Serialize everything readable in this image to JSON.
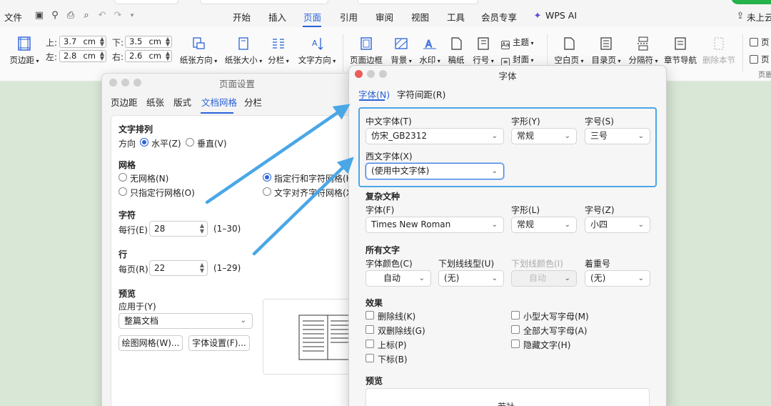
{
  "menu": {
    "file": "文件",
    "tabs": [
      "开始",
      "插入",
      "页面",
      "引用",
      "审阅",
      "视图",
      "工具",
      "会员专享",
      "WPS AI"
    ],
    "active_tab": "页面",
    "cloud": "未上云"
  },
  "ribbon": {
    "margins_btn": "页边距",
    "top_label": "上:",
    "top_value": "3.7",
    "top_unit": "cm",
    "bottom_label": "下:",
    "bottom_value": "3.5",
    "bottom_unit": "cm",
    "left_label": "左:",
    "left_value": "2.8",
    "left_unit": "cm",
    "right_label": "右:",
    "right_value": "2.6",
    "right_unit": "cm",
    "orientation": "纸张方向",
    "size": "纸张大小",
    "columns": "分栏",
    "text_direction": "文字方向",
    "page_border": "页面边框",
    "background": "背景",
    "watermark": "水印",
    "manuscript": "稿纸",
    "line_number": "行号",
    "theme": "主题",
    "cover": "封面",
    "blank_page": "空白页",
    "toc_page": "目录页",
    "separator": "分隔符",
    "section_nav": "章节导航",
    "delete_section": "删除本节",
    "partial_right_1": "页",
    "partial_right_2": "页",
    "partial_right_3": "页眉"
  },
  "page_setup": {
    "title": "页面设置",
    "partial_caption": "页面设置",
    "tabs": [
      "页边距",
      "纸张",
      "版式",
      "文档网格",
      "分栏"
    ],
    "active_tab": "文档网格",
    "text_layout_heading": "文字排列",
    "direction_label": "方向",
    "horizontal": "水平(Z)",
    "vertical": "垂直(V)",
    "grid_heading": "网格",
    "no_grid": "无网格(N)",
    "line_only": "只指定行网格(O)",
    "line_and_char": "指定行和字符网格(H)",
    "align_char": "文字对齐字符网格(X)",
    "chars_heading": "字符",
    "per_line_label": "每行(E)",
    "per_line_value": "28",
    "per_line_range": "(1–30)",
    "lines_heading": "行",
    "per_page_label": "每页(R)",
    "per_page_value": "22",
    "per_page_range": "(1–29)",
    "preview_heading": "预览",
    "apply_to_label": "应用于(Y)",
    "apply_to_value": "整篇文档",
    "draw_grid_btn": "绘图网格(W)...",
    "font_settings_btn": "字体设置(F)..."
  },
  "font_dialog": {
    "title": "字体",
    "tabs": [
      "字体(N)",
      "字符间距(R)"
    ],
    "active_tab": "字体(N)",
    "cn_font_label": "中文字体(T)",
    "cn_font_value": "仿宋_GB2312",
    "style_label": "字形(Y)",
    "style_value": "常规",
    "size_label": "字号(S)",
    "size_value": "三号",
    "west_font_label": "西文字体(X)",
    "west_font_value": "(使用中文字体)",
    "complex_heading": "复杂文种",
    "complex_font_label": "字体(F)",
    "complex_font_value": "Times New Roman",
    "complex_style_label": "字形(L)",
    "complex_style_value": "常规",
    "complex_size_label": "字号(Z)",
    "complex_size_value": "小四",
    "all_text_heading": "所有文字",
    "color_label": "字体颜色(C)",
    "color_value": "自动",
    "underline_label": "下划线线型(U)",
    "underline_value": "(无)",
    "underline_color_label": "下划线颜色(I)",
    "underline_color_value": "自动",
    "emphasis_label": "着重号",
    "emphasis_value": "(无)",
    "effects_heading": "效果",
    "strike": "删除线(K)",
    "double_strike": "双删除线(G)",
    "superscript": "上标(P)",
    "subscript": "下标(B)",
    "small_caps": "小型大写字母(M)",
    "all_caps": "全部大写字母(A)",
    "hidden": "隐藏文字(H)",
    "preview_heading": "预览",
    "preview_text": "若社"
  },
  "colors": {
    "accent": "#2b63d9",
    "highlight": "#4aa7e6",
    "arrow": "#4aa7e6"
  }
}
